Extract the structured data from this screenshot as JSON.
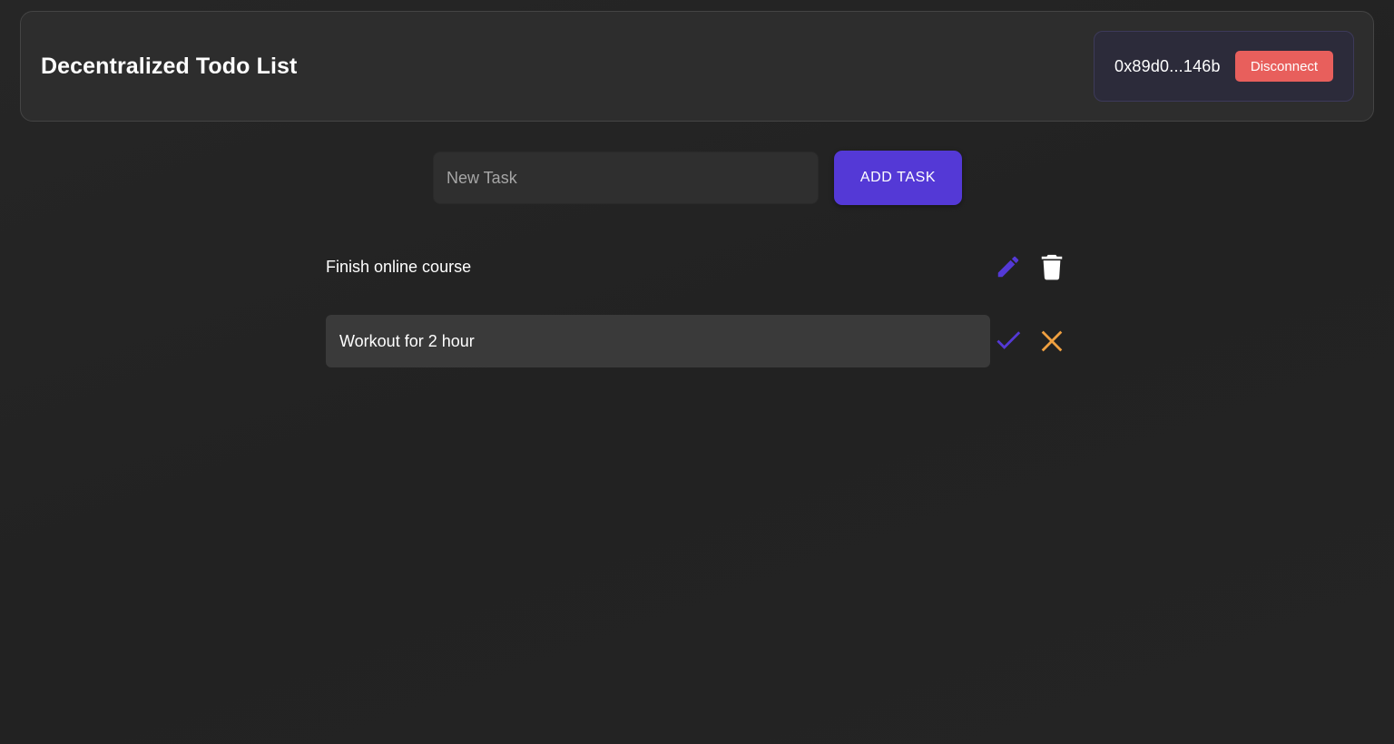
{
  "header": {
    "title": "Decentralized Todo List",
    "wallet_address": "0x89d0...146b",
    "disconnect_label": "Disconnect"
  },
  "new_task": {
    "placeholder": "New Task",
    "value": "",
    "add_label": "ADD TASK"
  },
  "tasks": [
    {
      "text": "Finish online course",
      "mode": "view",
      "actions": [
        "pencil-icon",
        "trash-icon"
      ]
    },
    {
      "text": "Workout for 2 hour",
      "mode": "edit",
      "actions": [
        "check-icon",
        "close-icon"
      ]
    }
  ],
  "colors": {
    "accent": "#5439d6",
    "danger": "#e85f5c",
    "cancel": "#f0a040",
    "background": "#242424",
    "card": "#2d2d2d"
  }
}
